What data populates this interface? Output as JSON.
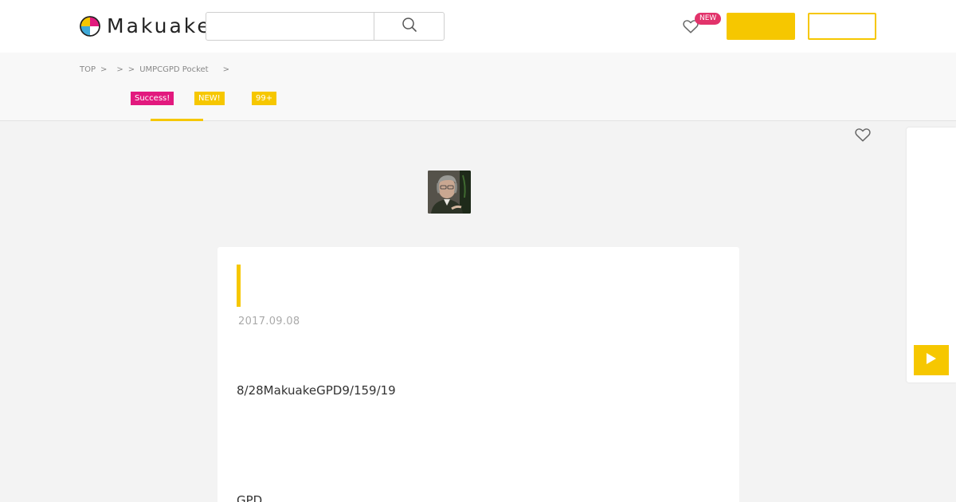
{
  "header": {
    "logo_text": "Makuake",
    "search": {
      "value": "",
      "placeholder": ""
    },
    "new_badge": "NEW",
    "primary_button_label": "",
    "secondary_button_label": ""
  },
  "breadcrumb": {
    "items": [
      "TOP",
      "",
      "",
      "UMPCGPD Pocket",
      ""
    ],
    "separator": ">"
  },
  "tabs": [
    {
      "badge": "Success!",
      "badge_color": "#e2197e",
      "active": true
    },
    {
      "badge": "NEW!",
      "badge_color": "#f6c700",
      "active": false
    },
    {
      "badge": "99+",
      "badge_color": "#f6c700",
      "active": false
    }
  ],
  "report": {
    "title": "",
    "date": "2017.09.08",
    "paragraphs": [
      "8/28MakuakeGPD9/159/19",
      "GPD"
    ]
  },
  "colors": {
    "accent": "#f6c700",
    "success": "#e2197e",
    "new_badge": "#e2336b"
  },
  "icons": {
    "search": "search-icon",
    "favorite": "heart-icon",
    "play": "play-icon"
  }
}
